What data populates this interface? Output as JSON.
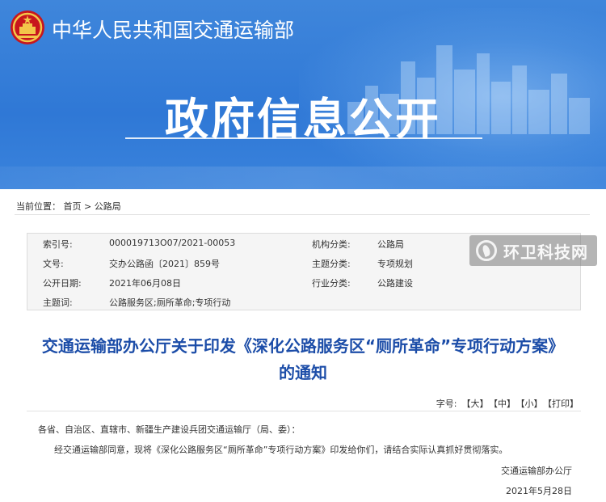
{
  "header": {
    "ministry_name": "中华人民共和国交通运输部",
    "banner_title": "政府信息公开",
    "emblem_icon": "national-emblem-icon"
  },
  "breadcrumb": {
    "prefix": "当前位置：",
    "home": "首页",
    "separator": ">",
    "current": "公路局"
  },
  "info": {
    "rows": [
      {
        "label": "索引号:",
        "value": "000019713O07/2021-00053",
        "label2": "机构分类:",
        "value2": "公路局"
      },
      {
        "label": "文号:",
        "value": "交办公路函〔2021〕859号",
        "label2": "主题分类:",
        "value2": "专项规划"
      },
      {
        "label": "公开日期:",
        "value": "2021年06月08日",
        "label2": "行业分类:",
        "value2": "公路建设"
      },
      {
        "label": "主题词:",
        "value": "公路服务区;厕所革命;专项行动",
        "label2": "",
        "value2": ""
      }
    ]
  },
  "watermark": {
    "text": "环卫科技网",
    "icon": "leaf-logo-icon"
  },
  "article": {
    "title_line1": "交通运输部办公厅关于印发《深化公路服务区“厕所革命”专项行动方案》",
    "title_line2": "的通知",
    "font_size_label": "字号:",
    "font_large": "【大】",
    "font_medium": "【中】",
    "font_small": "【小】",
    "print": "【打印】",
    "salutation": "各省、自治区、直辖市、新疆生产建设兵团交通运输厅（局、委）：",
    "body": "经交通运输部同意，现将《深化公路服务区“厕所革命”专项行动方案》印发给你们，请结合实际认真抓好贯彻落实。",
    "signature": "交通运输部办公厅",
    "date": "2021年5月28日"
  },
  "colors": {
    "banner_blue": "#3f86db",
    "title_blue": "#1c4da8"
  }
}
